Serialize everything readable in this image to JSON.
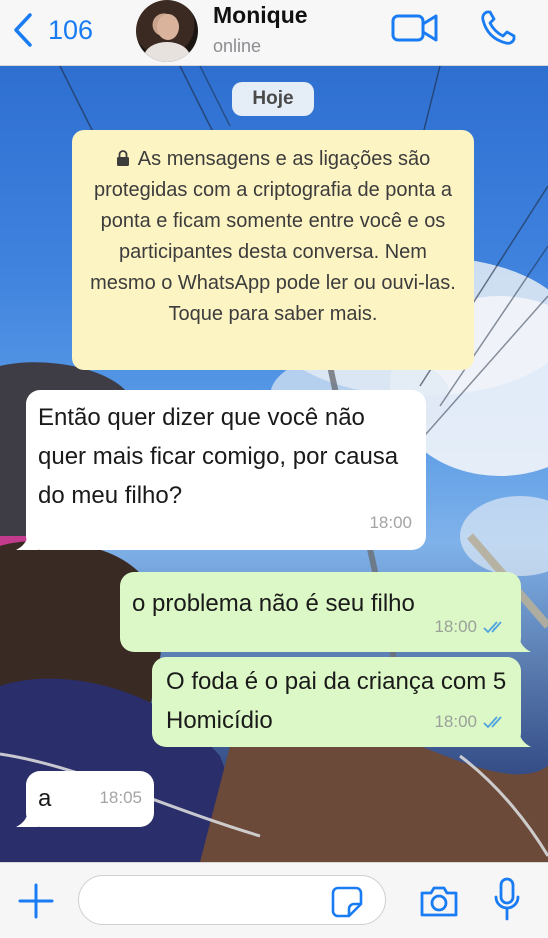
{
  "header": {
    "back_count": "106",
    "contact_name": "Monique",
    "contact_status": "online"
  },
  "chat": {
    "date_chip": "Hoje",
    "encryption_notice": "As mensagens e as ligações são protegidas com a criptografia de ponta a ponta e ficam somente entre você e os participantes desta conversa. Nem mesmo o WhatsApp pode ler ou ouvi-las. Toque para saber mais.",
    "messages": [
      {
        "direction": "in",
        "text": "Então quer dizer que você não quer mais ficar comigo, por causa do meu filho?",
        "time": "18:00"
      },
      {
        "direction": "out",
        "text": "o problema não é seu filho",
        "time": "18:00",
        "status": "read"
      },
      {
        "direction": "out",
        "text": "O foda é o pai da criança com 5 Homicídio",
        "time": "18:00",
        "status": "read"
      },
      {
        "direction": "in",
        "text": "a",
        "time": "18:05"
      }
    ]
  },
  "input": {
    "value": "",
    "placeholder": ""
  },
  "icons": {
    "back": "chevron-left-icon",
    "video": "video-camera-icon",
    "call": "phone-icon",
    "lock": "lock-icon",
    "read_ticks": "double-check-icon",
    "plus": "plus-icon",
    "sticker": "sticker-icon",
    "camera": "camera-icon",
    "mic": "microphone-icon"
  },
  "colors": {
    "accent": "#1a7cf2",
    "incoming_bubble": "#ffffff",
    "outgoing_bubble": "#dcf8c6",
    "notice_bg": "#fdf4c4",
    "read_tick": "#4fa3e0"
  }
}
